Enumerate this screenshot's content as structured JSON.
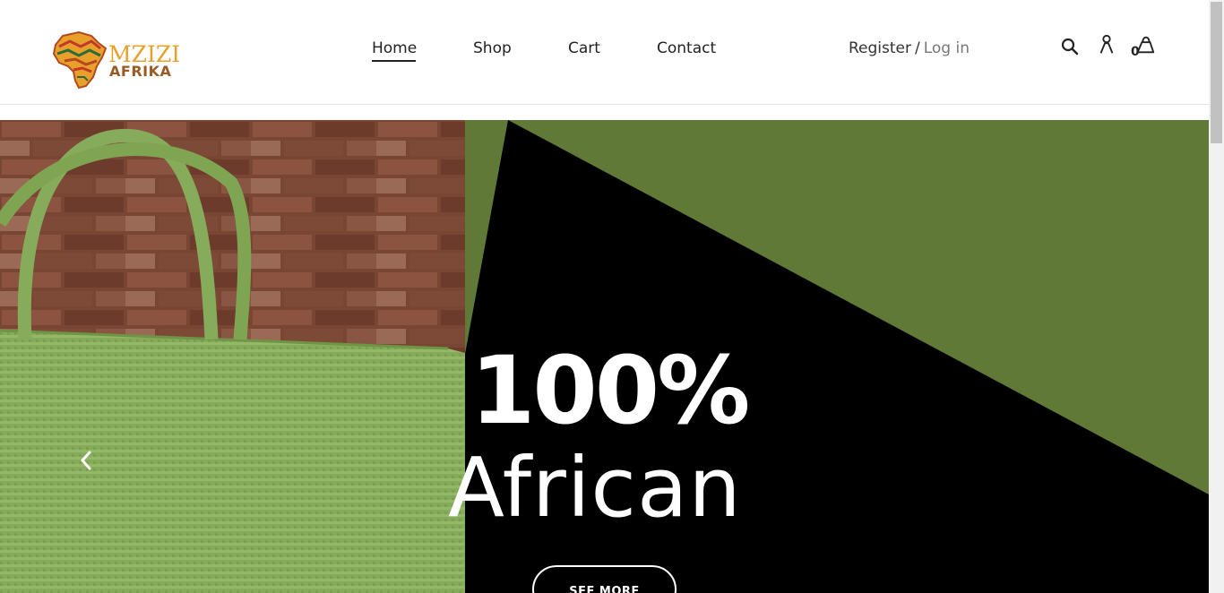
{
  "brand": {
    "line1": "MZIZI",
    "line2": "AFRIKA"
  },
  "nav": {
    "home": "Home",
    "shop": "Shop",
    "cart": "Cart",
    "contact": "Contact"
  },
  "auth": {
    "register": "Register",
    "separator": "/",
    "login": "Log in"
  },
  "header_icons": {
    "search": "search-icon",
    "account": "user-icon",
    "cart": "bag-icon",
    "cart_count": "0"
  },
  "hero": {
    "headline": "100%",
    "subheadline": "African",
    "button_label": "SEE MORE",
    "prev_icon": "chevron-left-icon"
  },
  "colors": {
    "hero_green": "#607937",
    "hero_black": "#000000",
    "brand_orange": "#e8a02a",
    "brand_brown": "#9a5a26"
  }
}
